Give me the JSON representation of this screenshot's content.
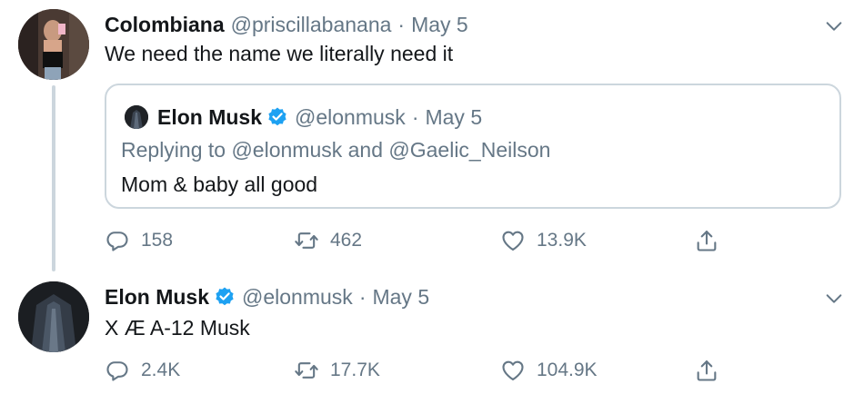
{
  "tweets": [
    {
      "author": {
        "name": "Colombiana",
        "handle": "@priscillabanana",
        "verified": false
      },
      "separator": "·",
      "date": "May 5",
      "text": "We need the name we literally need it",
      "quote": {
        "author": {
          "name": "Elon Musk",
          "handle": "@elonmusk",
          "verified": true
        },
        "separator": "·",
        "date": "May 5",
        "replying_to": "Replying to @elonmusk and @Gaelic_Neilson",
        "text": "Mom & baby all good"
      },
      "stats": {
        "replies": "158",
        "retweets": "462",
        "likes": "13.9K"
      }
    },
    {
      "author": {
        "name": "Elon Musk",
        "handle": "@elonmusk",
        "verified": true
      },
      "separator": "·",
      "date": "May 5",
      "text": "X Æ A-12 Musk",
      "stats": {
        "replies": "2.4K",
        "retweets": "17.7K",
        "likes": "104.9K"
      }
    }
  ],
  "icons": {
    "reply": "reply-icon",
    "retweet": "retweet-icon",
    "like": "heart-icon",
    "share": "share-icon",
    "more": "chevron-down-icon",
    "verified": "verified-badge-icon"
  },
  "colors": {
    "text": "#14171a",
    "muted": "#657786",
    "verified": "#1da1f2",
    "border": "#ccd6dd"
  }
}
